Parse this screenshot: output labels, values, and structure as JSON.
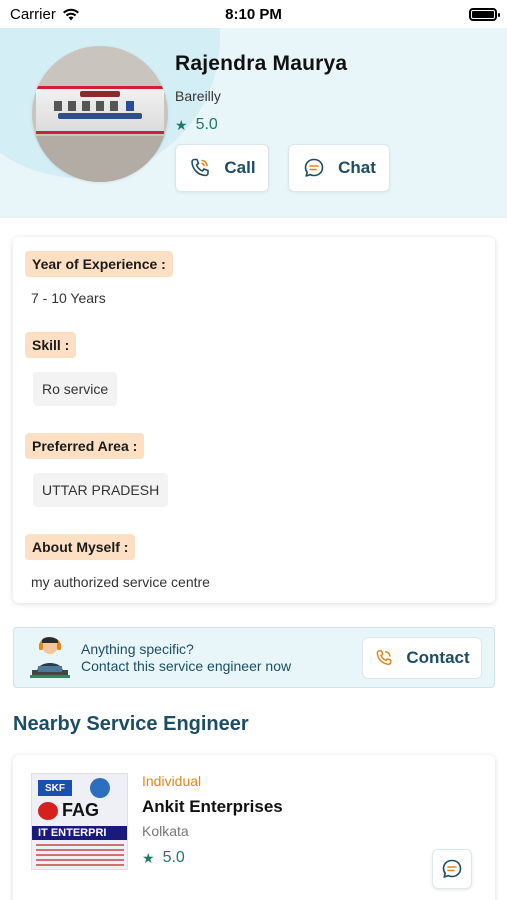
{
  "status_bar": {
    "carrier": "Carrier",
    "time": "8:10 PM"
  },
  "profile": {
    "name": "Rajendra Maurya",
    "city": "Bareilly",
    "rating": "5.0",
    "call_label": "Call",
    "chat_label": "Chat"
  },
  "details": {
    "experience_label": "Year of Experience :",
    "experience_value": "7 - 10 Years",
    "skill_label": "Skill :",
    "skills": [
      "Ro service"
    ],
    "area_label": "Preferred Area :",
    "areas": [
      "UTTAR PRADESH"
    ],
    "about_label": "About Myself :",
    "about_value": "my authorized service centre"
  },
  "contact_banner": {
    "line1": "Anything specific?",
    "line2": "Contact this service engineer now",
    "button_label": "Contact"
  },
  "nearby": {
    "title": "Nearby Service Engineer",
    "items": [
      {
        "type": "Individual",
        "name": "Ankit Enterprises",
        "city": "Kolkata",
        "rating": "5.0"
      }
    ]
  },
  "colors": {
    "accent": "#1d4d63",
    "rating_green": "#1f7a6b",
    "tag_bg": "#fde0c4",
    "header_bg": "#e9f6f9",
    "type_orange": "#e0861a"
  }
}
